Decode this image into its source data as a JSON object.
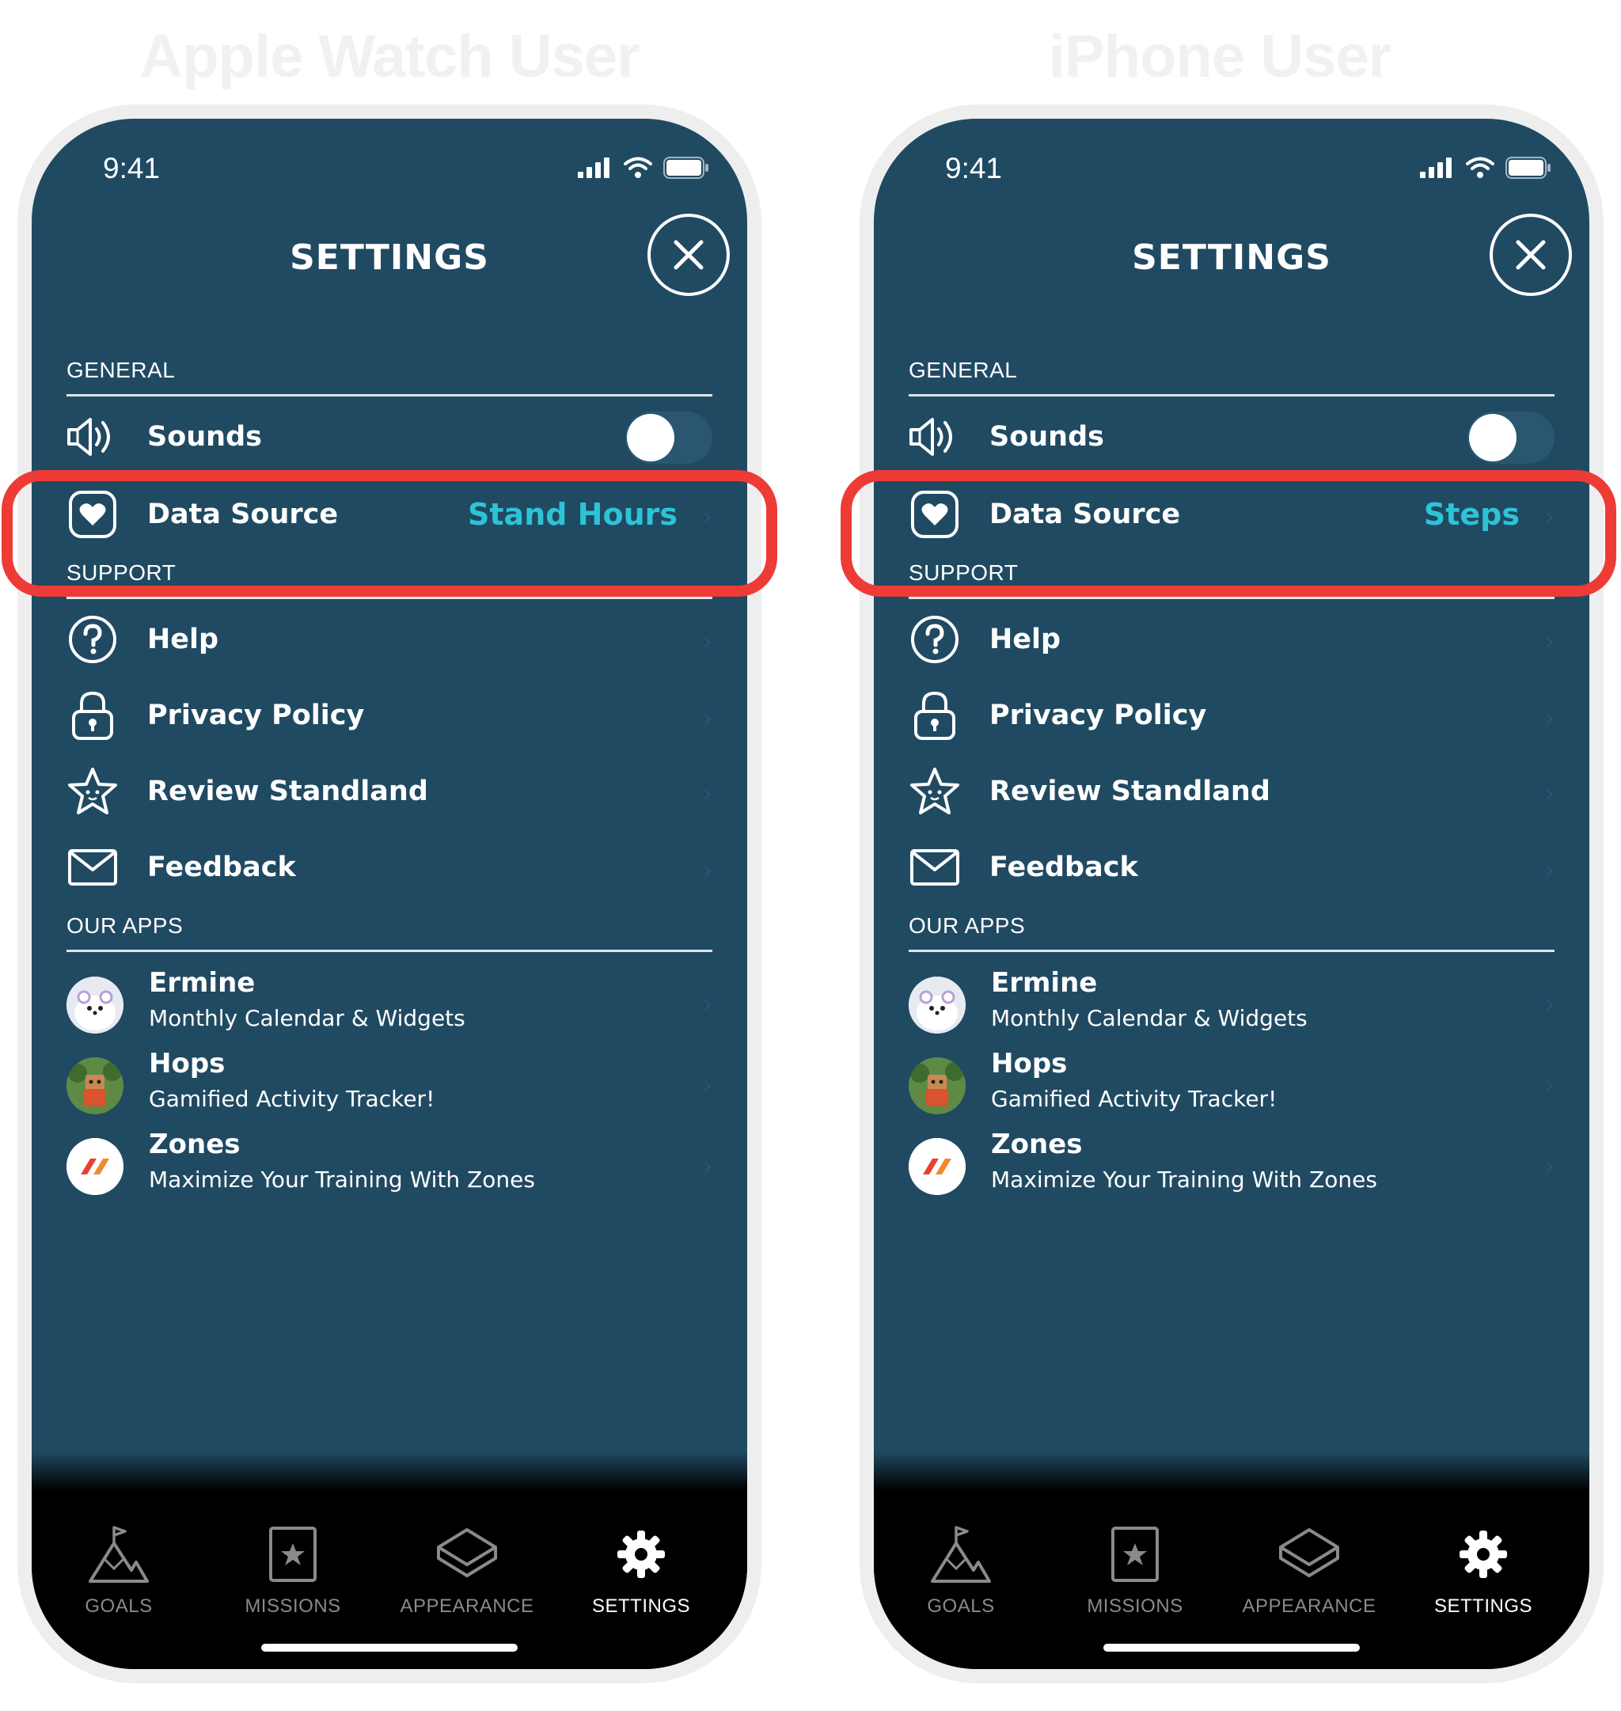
{
  "titles": {
    "left": "Apple Watch User",
    "right": "iPhone User"
  },
  "status": {
    "time": "9:41"
  },
  "header": {
    "title": "SETTINGS"
  },
  "sections": {
    "general": "GENERAL",
    "support": "SUPPORT",
    "apps": "OUR APPS"
  },
  "rows": {
    "sounds": "Sounds",
    "data_source": "Data Source",
    "help": "Help",
    "privacy": "Privacy Policy",
    "review": "Review Standland",
    "feedback": "Feedback"
  },
  "data_source_values": {
    "left": "Stand Hours",
    "right": "Steps"
  },
  "apps": [
    {
      "name": "Ermine",
      "subtitle": "Monthly Calendar & Widgets"
    },
    {
      "name": "Hops",
      "subtitle": "Gamified Activity Tracker!"
    },
    {
      "name": "Zones",
      "subtitle": "Maximize Your Training With Zones"
    }
  ],
  "tabs": [
    {
      "label": "GOALS",
      "icon": "mountain-flag-icon"
    },
    {
      "label": "MISSIONS",
      "icon": "star-card-icon"
    },
    {
      "label": "APPEARANCE",
      "icon": "layers-icon"
    },
    {
      "label": "SETTINGS",
      "icon": "gear-icon",
      "active": true
    }
  ],
  "colors": {
    "screen_bg": "#204a62",
    "accent": "#2ec3d6",
    "highlight": "#ee3b36",
    "tabbar": "#000000"
  }
}
